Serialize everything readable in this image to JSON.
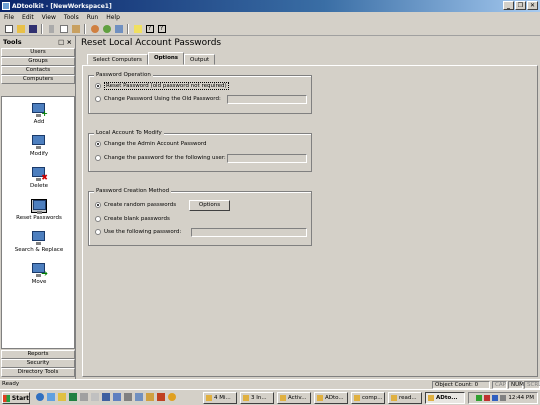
{
  "window": {
    "title": "ADtoolkit - [NewWorkspace1]"
  },
  "menu": [
    "File",
    "Edit",
    "View",
    "Tools",
    "Run",
    "Help"
  ],
  "toolbar_icons": [
    "new-icon",
    "open-icon",
    "save-icon",
    "cut-icon",
    "copy-icon",
    "paste-icon",
    "user-icon",
    "group-icon",
    "computer-icon",
    "help-icon",
    "whats-this-icon",
    "about-icon"
  ],
  "tools": {
    "header": "Tools",
    "header_controls": "□ ×",
    "categories_top": [
      "Users",
      "Groups",
      "Contacts",
      "Computers"
    ],
    "actions": [
      {
        "label": "Add",
        "badge": "+"
      },
      {
        "label": "Modify",
        "badge": ""
      },
      {
        "label": "Delete",
        "badge": "✖"
      },
      {
        "label": "Reset Passwords",
        "badge": ""
      },
      {
        "label": "Search & Replace",
        "badge": ""
      },
      {
        "label": "Move",
        "badge": "➔"
      }
    ],
    "categories_bottom": [
      "Reports",
      "Security",
      "Directory Tools"
    ]
  },
  "main": {
    "title": "Reset Local Account Passwords",
    "tabs": [
      "Select Computers",
      "Options",
      "Output"
    ],
    "active_tab": "Options",
    "password_operation": {
      "label": "Password Operation",
      "option1": "Reset Password (old password not required)",
      "option2": "Change Password Using the Old Password:"
    },
    "local_account": {
      "label": "Local Account To Modify",
      "option1": "Change the Admin Account Password",
      "option2": "Change the password for the following user:"
    },
    "creation_method": {
      "label": "Password Creation Method",
      "option1": "Create random passwords",
      "option2": "Create blank passwords",
      "option3": "Use the following password:",
      "options_button": "Options"
    }
  },
  "status": {
    "left": "Ready",
    "object_count": "Object Count: 0",
    "indicators": [
      "CAP",
      "NUM",
      "SCRL"
    ]
  },
  "taskbar": {
    "start": "Start",
    "tasks": [
      "4 Mi...",
      "3 In...",
      "Activ...",
      "ADto...",
      "comp...",
      "read...",
      "ADto..."
    ],
    "active_task_index": 6,
    "clock": "12:44 PM"
  },
  "colors": {
    "title_start": "#0a246a",
    "title_end": "#a6caf0",
    "face": "#d4d0c8"
  }
}
